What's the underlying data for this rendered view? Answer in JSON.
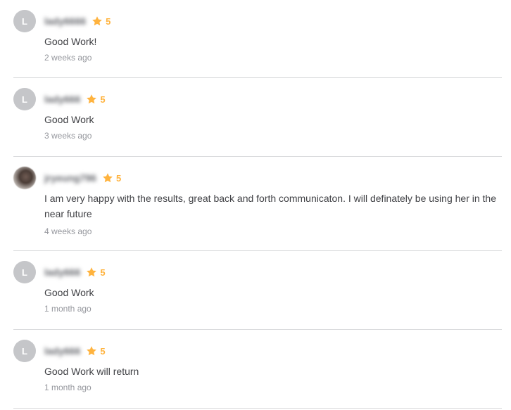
{
  "reviews": [
    {
      "avatar_letter": "L",
      "avatar_type": "letter",
      "username": "lady6666",
      "rating": "5",
      "text": "Good Work!",
      "time": "2 weeks ago"
    },
    {
      "avatar_letter": "L",
      "avatar_type": "letter",
      "username": "lady666",
      "rating": "5",
      "text": "Good Work",
      "time": "3 weeks ago"
    },
    {
      "avatar_letter": "",
      "avatar_type": "photo",
      "username": "jryeung796",
      "rating": "5",
      "text": "I am very happy with the results, great back and forth communicaton. I will definately be using her in the near future",
      "time": "4 weeks ago"
    },
    {
      "avatar_letter": "L",
      "avatar_type": "letter",
      "username": "lady666",
      "rating": "5",
      "text": "Good Work",
      "time": "1 month ago"
    },
    {
      "avatar_letter": "L",
      "avatar_type": "letter",
      "username": "lady666",
      "rating": "5",
      "text": "Good Work will return",
      "time": "1 month ago"
    }
  ],
  "icons": {
    "rating": "star-icon"
  },
  "colors": {
    "star": "#ffb33e",
    "avatar_bg": "#c5c6c9",
    "divider": "#dadbdd",
    "muted": "#95979d"
  }
}
